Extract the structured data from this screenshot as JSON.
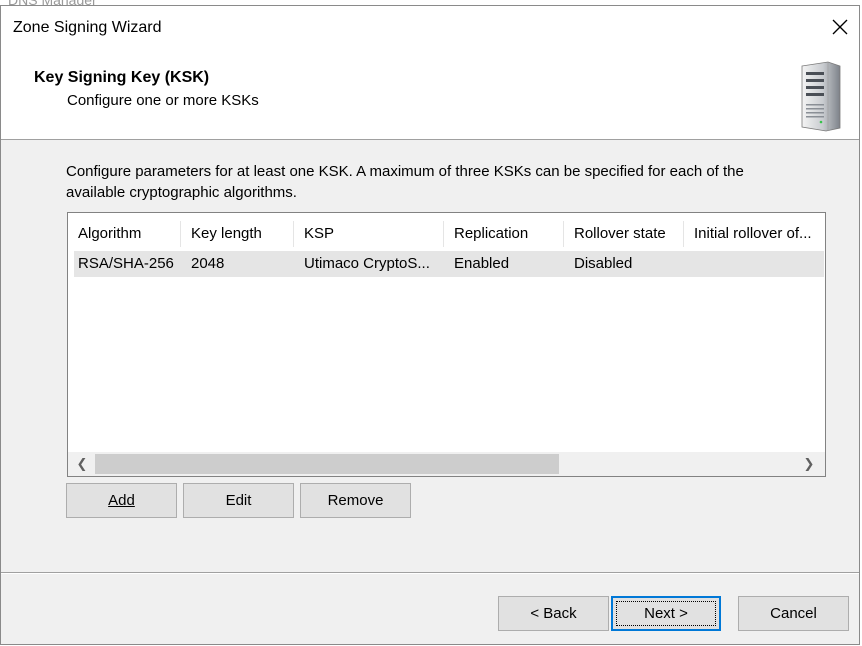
{
  "background": {
    "app_title": "DNS Manager"
  },
  "window": {
    "title": "Zone Signing Wizard"
  },
  "header": {
    "title": "Key Signing Key (KSK)",
    "subtitle": "Configure one or more KSKs"
  },
  "description": {
    "line1": "Configure parameters for at least one KSK. A maximum of three KSKs can be specified for each of the",
    "line2": "available cryptographic algorithms."
  },
  "table": {
    "columns": [
      "Algorithm",
      "Key length",
      "KSP",
      "Replication",
      "Rollover state",
      "Initial rollover of..."
    ],
    "rows": [
      [
        "RSA/SHA-256",
        "2048",
        "Utimaco CryptoS...",
        "Enabled",
        "Disabled",
        ""
      ]
    ]
  },
  "list_buttons": {
    "add": "Add",
    "edit": "Edit",
    "remove": "Remove"
  },
  "footer_buttons": {
    "back": "< Back",
    "next": "Next >",
    "cancel": "Cancel"
  },
  "colors": {
    "accent": "#0078d7",
    "selected_row": "#e5e5e5",
    "window_bg": "#f0f0f0"
  }
}
